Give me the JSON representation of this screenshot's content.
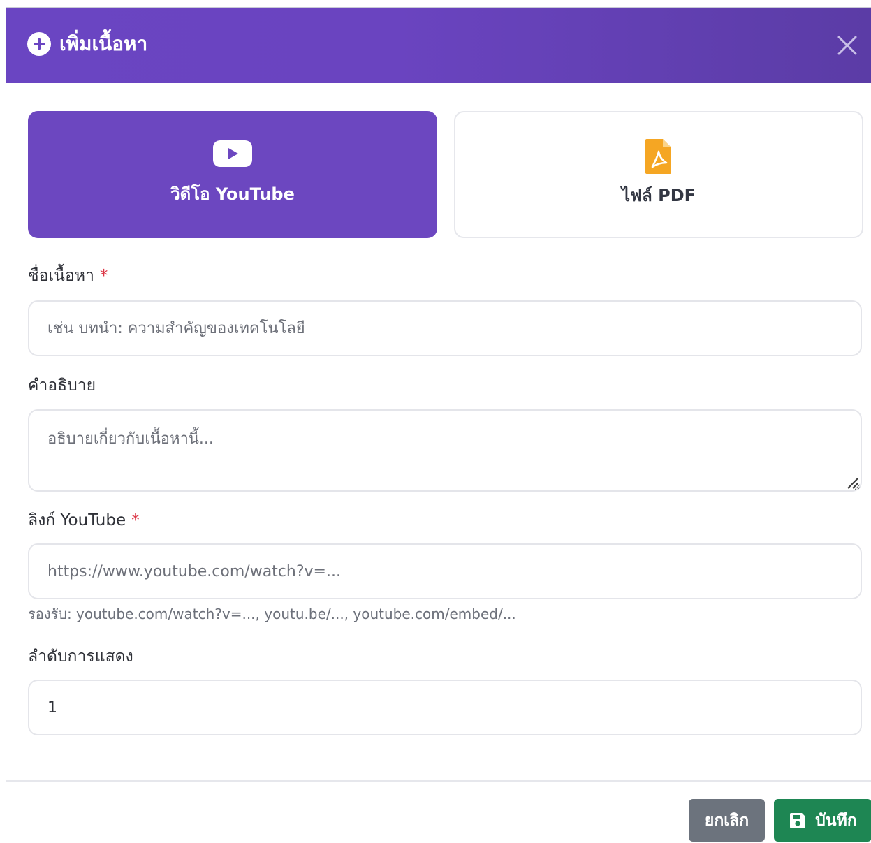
{
  "modal": {
    "title": "เพิ่มเนื้อหา",
    "header_icon": "plus-circle-icon",
    "close_icon": "close-icon",
    "colors": {
      "header": "#6a45c2",
      "accent": "#6c47c0",
      "save": "#1e8653",
      "cancel": "#6c737d",
      "required": "#dc3545",
      "pdf_icon": "#f5a623"
    }
  },
  "content_types": [
    {
      "label": "วิดีโอ YouTube",
      "icon": "youtube-play-icon",
      "selected": true
    },
    {
      "label": "ไฟล์ PDF",
      "icon": "pdf-file-icon",
      "selected": false
    }
  ],
  "fields": {
    "title": {
      "label": "ชื่อเนื้อหา",
      "required_mark": "*",
      "placeholder": "เช่น บทนำ: ความสำคัญของเทคโนโลยี"
    },
    "description": {
      "label": "คำอธิบาย",
      "placeholder": "อธิบายเกี่ยวกับเนื้อหานี้..."
    },
    "youtube_link": {
      "label": "ลิงก์ YouTube",
      "required_mark": "*",
      "placeholder": "https://www.youtube.com/watch?v=...",
      "help": "รองรับ: youtube.com/watch?v=..., youtu.be/..., youtube.com/embed/..."
    },
    "display_order": {
      "label": "ลำดับการแสดง",
      "value": "1"
    }
  },
  "footer": {
    "cancel_label": "ยกเลิก",
    "save_label": "บันทึก",
    "save_icon": "floppy-disk-icon"
  }
}
